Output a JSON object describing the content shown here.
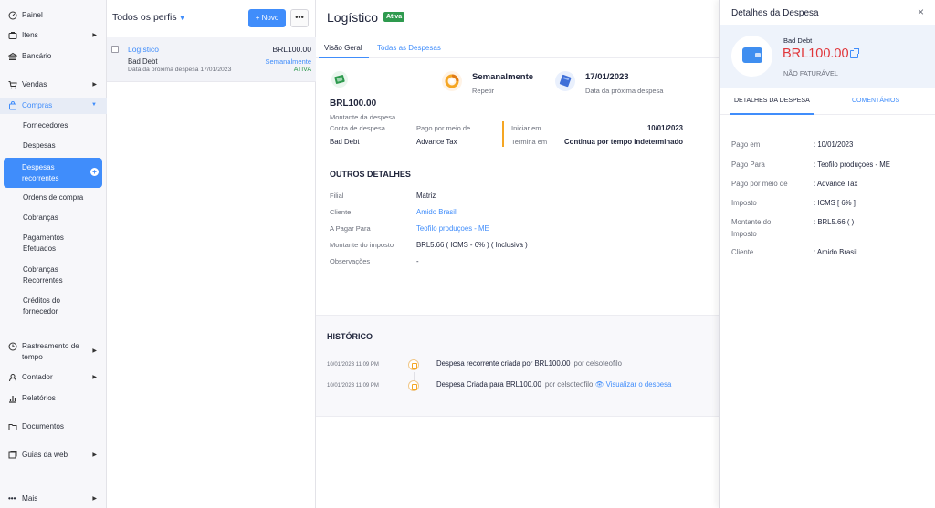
{
  "sidebar": {
    "items": [
      {
        "label": "Painel",
        "icon": "dashboard-icon"
      },
      {
        "label": "Itens",
        "icon": "tag-icon"
      },
      {
        "label": "Bancário",
        "icon": "bank-icon"
      },
      {
        "label": "Vendas",
        "icon": "cart-icon"
      },
      {
        "label": "Compras",
        "icon": "shopping-bag-icon"
      },
      {
        "label": "Rastreamento de tempo",
        "icon": "clock-icon"
      },
      {
        "label": "Contador",
        "icon": "user-icon"
      },
      {
        "label": "Relatórios",
        "icon": "bar-chart-icon"
      },
      {
        "label": "Documentos",
        "icon": "folder-icon"
      },
      {
        "label": "Guias da web",
        "icon": "web-tabs-icon"
      },
      {
        "label": "Mais",
        "icon": "more-dots-icon"
      }
    ],
    "compras_sub": [
      "Fornecedores",
      "Despesas",
      "Despesas recorrentes",
      "Ordens de compra",
      "Cobranças",
      "Pagamentos Efetuados",
      "Cobranças Recorrentes",
      "Créditos do fornecedor"
    ]
  },
  "list": {
    "title": "Todos os perfis",
    "new_label": "+ Novo",
    "more_label": "•••",
    "row": {
      "name": "Logístico",
      "amount": "BRL100.00",
      "account": "Bad Debt",
      "frequency": "Semanalmente",
      "next_date": "Data da próxima despesa 17/01/2023",
      "status": "ATIVA"
    }
  },
  "main": {
    "title": "Logístico",
    "badge": "Ativa",
    "tabs": [
      "Visão Geral",
      "Todas as Despesas"
    ],
    "summary": {
      "amount": "BRL100.00",
      "amount_label": "Montante da despesa",
      "frequency": "Semanalmente",
      "frequency_label": "Repetir",
      "next_date": "17/01/2023",
      "next_date_label": "Data da próxima despesa",
      "account_label": "Conta de despesa",
      "account_value": "Bad Debt",
      "paid_via_label": "Pago por meio de",
      "paid_via_value": "Advance Tax",
      "start_label": "Iniciar em",
      "start_value": "10/01/2023",
      "end_label": "Termina em",
      "end_value": "Continua por tempo indeterminado"
    },
    "other": {
      "title": "OUTROS DETALHES",
      "rows": [
        {
          "label": "Filial",
          "value": "Matriz"
        },
        {
          "label": "Cliente",
          "value": "Amido Brasil"
        },
        {
          "label": "A Pagar Para",
          "value": "Teofilo produçoes - ME"
        },
        {
          "label": "Montante do imposto",
          "value": "BRL5.66 ( ICMS - 6% ) ( Inclusiva )"
        },
        {
          "label": "Observações",
          "value": "-"
        }
      ]
    },
    "history": {
      "title": "HISTÓRICO",
      "entries": [
        {
          "date": "10/01/2023 11:09 PM",
          "text": "Despesa recorrente criada por BRL100.00",
          "by": "por celsoteofilo",
          "link": ""
        },
        {
          "date": "10/01/2023 11:09 PM",
          "text": "Despesa Criada para BRL100.00",
          "by": "por celsoteofilo",
          "link": "Visualizar o despesa"
        }
      ]
    }
  },
  "panel": {
    "title": "Detalhes da Despesa",
    "close": "×",
    "category": "Bad Debt",
    "amount": "BRL100.00",
    "billing": "NÃO FATURÁVEL",
    "tabs": [
      "DETALHES DA DESPESA",
      "COMENTÁRIOS"
    ],
    "details": [
      {
        "label": "Pago em",
        "value": ": 10/01/2023"
      },
      {
        "label": "Pago Para",
        "value": ": Teofilo produçoes - ME"
      },
      {
        "label": "Pago por meio de",
        "value": ": Advance Tax"
      },
      {
        "label": "Imposto",
        "value": ": ICMS [ 6% ]"
      },
      {
        "label": "Montante do Imposto",
        "value": ": BRL5.66 ( )"
      },
      {
        "label": "Cliente",
        "value": ": Amido Brasil"
      }
    ]
  },
  "colors": {
    "accent": "#408dfb",
    "active_badge": "#2e9a4e",
    "amount_red": "#e0353a",
    "history_icon": "#f5a623"
  }
}
